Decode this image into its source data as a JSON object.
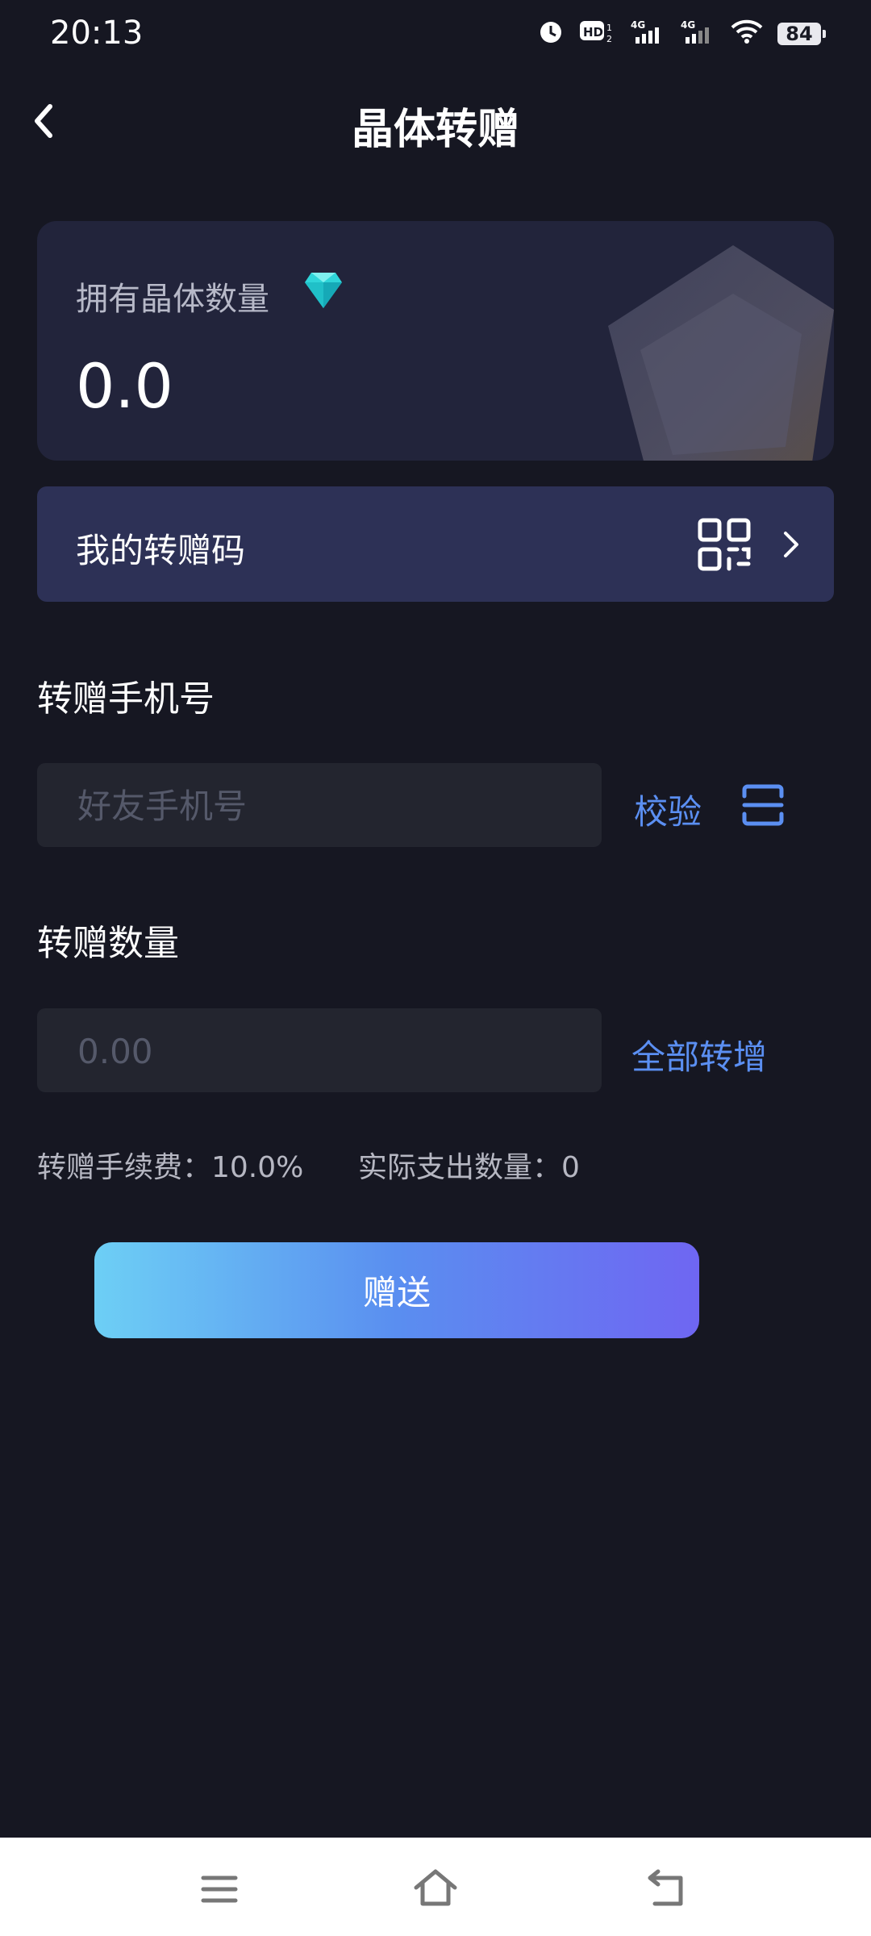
{
  "status": {
    "time": "20:13",
    "battery": "84"
  },
  "header": {
    "title": "晶体转赠"
  },
  "balance": {
    "label": "拥有晶体数量",
    "value": "0.0"
  },
  "transfer_code": {
    "label": "我的转赠码"
  },
  "phone": {
    "section_label": "转赠手机号",
    "placeholder": "好友手机号",
    "verify_label": "校验"
  },
  "amount": {
    "section_label": "转赠数量",
    "placeholder": "0.00",
    "transfer_all_label": "全部转增"
  },
  "fees": {
    "fee_text": "转赠手续费：10.0%",
    "actual_text": "实际支出数量：0"
  },
  "submit": {
    "label": "赠送"
  },
  "colors": {
    "background": "#161722",
    "accent_blue": "#5b8ff2",
    "card": "#22243b",
    "code_row": "#2d3156"
  },
  "icons": [
    "back-arrow-icon",
    "diamond-icon",
    "qr-code-icon",
    "chevron-right-icon",
    "scan-icon",
    "menu-icon",
    "home-icon",
    "back-icon"
  ]
}
